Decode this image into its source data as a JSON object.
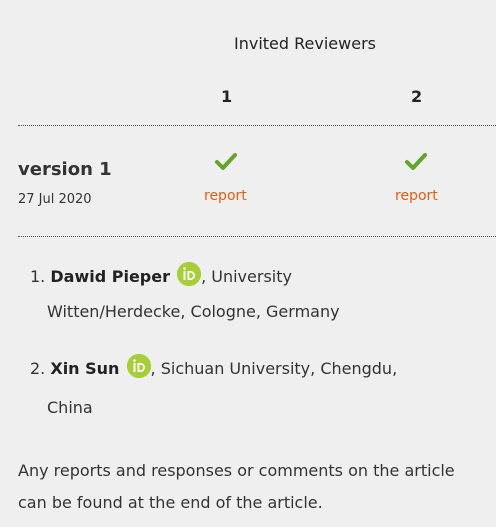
{
  "header": {
    "title": "Invited Reviewers",
    "reviewer_numbers": [
      "1",
      "2"
    ]
  },
  "versions": [
    {
      "label": "version 1",
      "date": "27 Jul 2020",
      "reports": [
        {
          "status": "approved",
          "link_label": "report"
        },
        {
          "status": "approved",
          "link_label": "report"
        }
      ]
    }
  ],
  "reviewers": [
    {
      "number": "1.",
      "name": "Dawid Pieper",
      "affiliation_line1": ", University",
      "affiliation_line2": "Witten/Herdecke, Cologne, Germany",
      "icon": "orcid-icon"
    },
    {
      "number": "2.",
      "name": "Xin Sun",
      "affiliation_line1": ", Sichuan University, Chengdu,",
      "affiliation_line2": "China",
      "icon": "orcid-icon"
    }
  ],
  "footer": {
    "note": "Any reports and responses or comments on the article can be found at the end of the article."
  },
  "colors": {
    "check": "#63a528",
    "report_link": "#e25c12",
    "orcid": "#a6ce39",
    "background": "#efefef"
  }
}
